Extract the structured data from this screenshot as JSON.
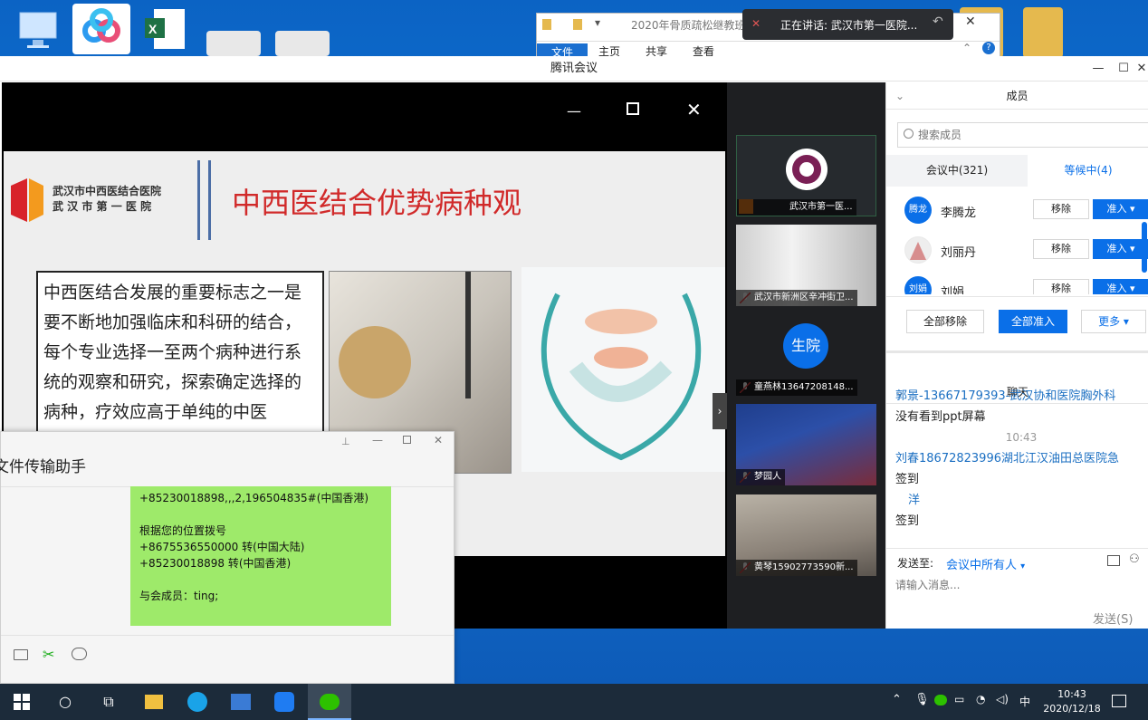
{
  "explorer": {
    "title": "2020年骨质疏松继教班",
    "tabs": [
      "文件",
      "主页",
      "共享",
      "查看"
    ]
  },
  "speaking": {
    "text": "正在讲话: 武汉市第一医院..."
  },
  "meeting": {
    "title": "腾讯会议",
    "slide": {
      "hospital_line1": "武汉市中西医结合医院",
      "hospital_line2": "武 汉 市 第 一 医 院",
      "title": "中西医结合优势病种观",
      "body": "中西医结合发展的重要标志之一是要不断地加强临床和科研的结合，每个专业选择一至两个病种进行系统的观察和研究，探索确定选择的病种，疗效应高于单纯的中医"
    },
    "tiles": [
      {
        "name": "武汉市第一医..."
      },
      {
        "name": "武汉市新洲区辛冲街卫..."
      },
      {
        "avatar": "生院",
        "name": "童燕林13647208148..."
      },
      {
        "name": "梦园人"
      },
      {
        "name": "黄琴15902773590新..."
      }
    ],
    "members": {
      "header": "成员",
      "search_placeholder": "搜索成员",
      "tab_in_meeting": "会议中(321)",
      "tab_waiting": "等候中(4)",
      "waiting": [
        {
          "avatar": "腾龙",
          "name": "李腾龙",
          "remove": "移除",
          "admit": "准入"
        },
        {
          "avatar": "",
          "name": "刘丽丹",
          "remove": "移除",
          "admit": "准入"
        },
        {
          "avatar": "刘娟",
          "name": "刘娟",
          "remove": "移除",
          "admit": "准入"
        }
      ],
      "remove_all": "全部移除",
      "admit_all": "全部准入",
      "more": "更多"
    },
    "chat": {
      "header": "聊天",
      "messages": [
        {
          "sender": "郭景-13667179393-武汉协和医院胸外科",
          "text": "没有看到ppt屏幕"
        },
        {
          "time": "10:43"
        },
        {
          "sender": "刘春18672823996湖北江汉油田总医院急",
          "text": "签到"
        },
        {
          "sender": "洋",
          "text": "签到"
        }
      ],
      "send_to_label": "发送至:",
      "send_to_value": "会议中所有人",
      "input_placeholder": "请输入消息...",
      "send_button": "发送(S)"
    }
  },
  "wechat": {
    "title": "文件传输助手",
    "message_lines": [
      "+85230018898,,,2,196504835#(中国香港)",
      "",
      "根据您的位置拨号",
      "+8675536550000 转(中国大陆)",
      "+85230018898 转(中国香港)",
      "",
      "与会成员：ting;"
    ]
  },
  "taskbar": {
    "time": "10:43",
    "date": "2020/12/18",
    "ime": "中"
  }
}
